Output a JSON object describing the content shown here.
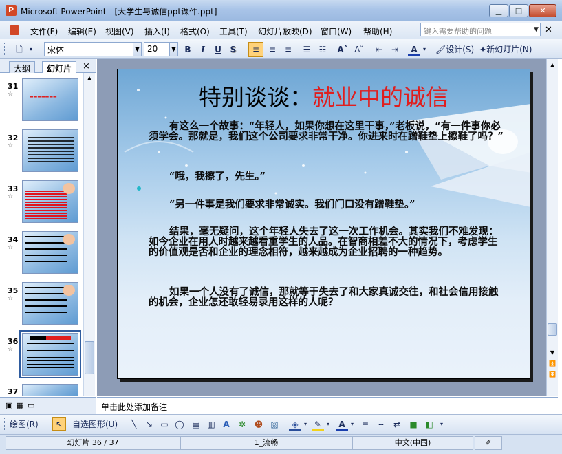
{
  "window": {
    "title": "Microsoft PowerPoint - [大学生与诚信ppt课件.ppt]",
    "app_icon": "P"
  },
  "menu": {
    "items": [
      "文件(F)",
      "编辑(E)",
      "视图(V)",
      "插入(I)",
      "格式(O)",
      "工具(T)",
      "幻灯片放映(D)",
      "窗口(W)",
      "帮助(H)"
    ],
    "help_placeholder": "键入需要帮助的问题"
  },
  "toolbar": {
    "font_name": "宋体",
    "font_size": "20",
    "bold": "B",
    "italic": "I",
    "underline": "U",
    "shadow": "S",
    "design_label": "设计(S)",
    "new_slide_label": "新幻灯片(N)"
  },
  "panes": {
    "tabs": [
      "大纲",
      "幻灯片"
    ],
    "close": "×",
    "thumbnails": [
      {
        "num": "31",
        "selected": false
      },
      {
        "num": "32",
        "selected": false
      },
      {
        "num": "33",
        "selected": false
      },
      {
        "num": "34",
        "selected": false
      },
      {
        "num": "35",
        "selected": false
      },
      {
        "num": "36",
        "selected": true
      },
      {
        "num": "37",
        "selected": false
      }
    ]
  },
  "slide": {
    "title_part1": "特别谈谈：",
    "title_part2": "就业中的诚信",
    "paragraphs": [
      "有这么一个故事：“年轻人，如果你想在这里干事，”老板说，“有一件事你必须学会。那就是，我们这个公司要求非常干净。你进来时在蹭鞋垫上擦鞋了吗？”",
      "“哦，我擦了，先生。”",
      "“另一件事是我们要求非常诚实。我们门口没有蹭鞋垫。”",
      "结果，毫无疑问，这个年轻人失去了这一次工作机会。其实我们不难发现：如今企业在用人时越来越看重学生的人品。在智商相差不大的情况下，考虑学生的价值观是否和企业的理念相符，越来越成为企业招聘的一种趋势。",
      "如果一个人没有了诚信，那就等于失去了和大家真诚交往，和社会信用接触的机会，企业怎还敢轻易录用这样的人呢？"
    ]
  },
  "notes": {
    "placeholder": "单击此处添加备注"
  },
  "drawing": {
    "draw_label": "绘图(R)",
    "autoshapes_label": "自选图形(U)"
  },
  "status": {
    "slide_info": "幻灯片 36 / 37",
    "design": "1_流畅",
    "language": "中文(中国)"
  },
  "colors": {
    "title_black": "#000000",
    "title_red": "#e01e1e",
    "accent_blue": "#2f5c9f"
  }
}
